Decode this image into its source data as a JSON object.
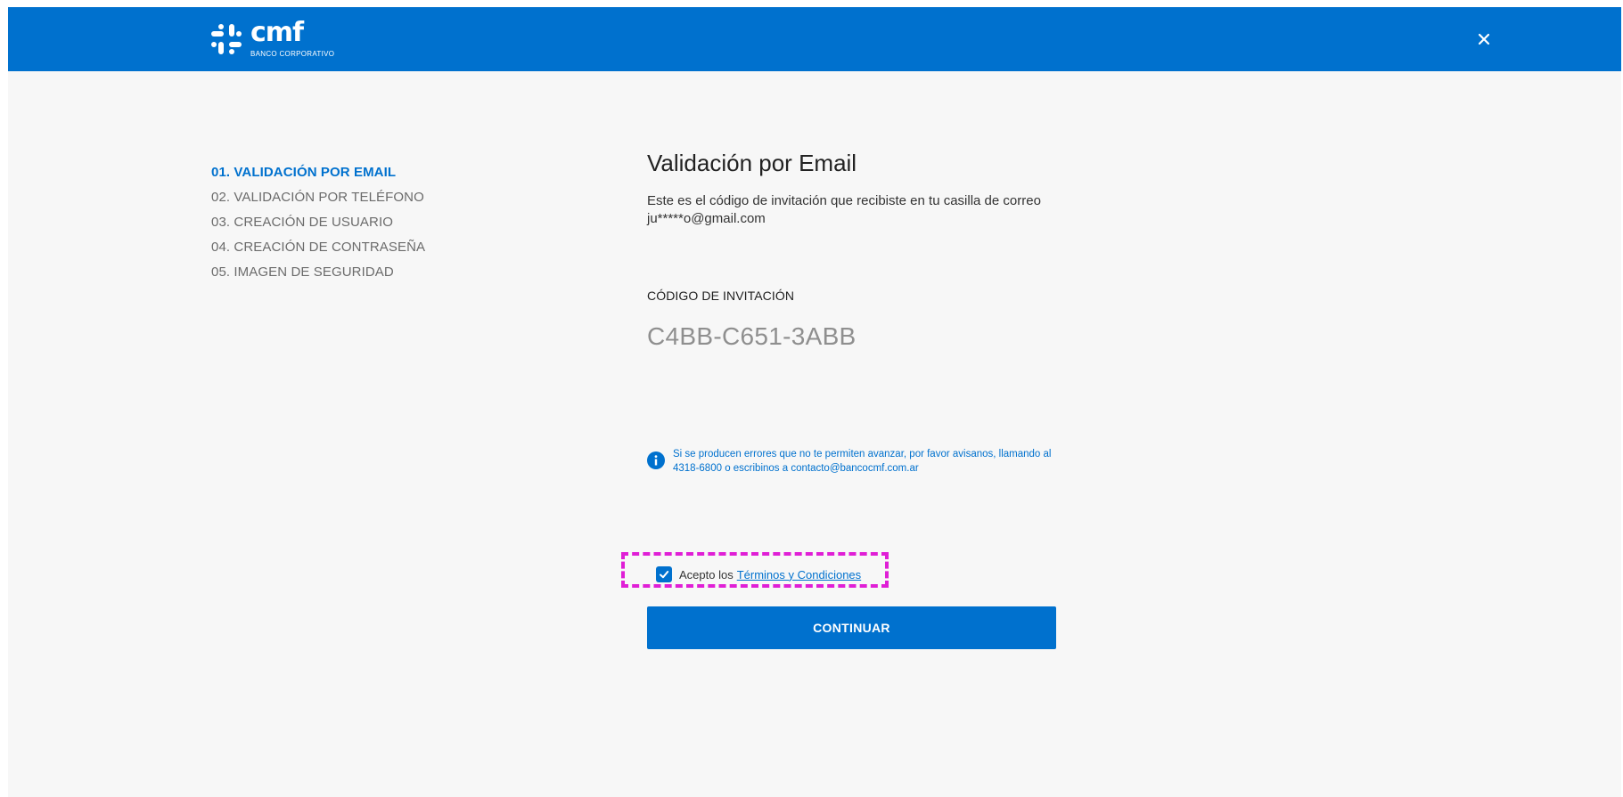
{
  "header": {
    "brand_name": "cmf",
    "brand_subtitle": "BANCO CORPORATIVO",
    "close_icon": "close-icon"
  },
  "steps": [
    {
      "label": "01. VALIDACIÓN POR EMAIL",
      "active": true
    },
    {
      "label": "02. VALIDACIÓN POR TELÉFONO",
      "active": false
    },
    {
      "label": "03. CREACIÓN DE USUARIO",
      "active": false
    },
    {
      "label": "04. CREACIÓN DE CONTRASEÑA",
      "active": false
    },
    {
      "label": "05. IMAGEN DE SEGURIDAD",
      "active": false
    }
  ],
  "main": {
    "title": "Validación por Email",
    "description": "Este es el código de invitación que recibiste en tu casilla de correo  ju*****o@gmail.com",
    "code_label": "CÓDIGO DE INVITACIÓN",
    "code_value": "C4BB-C651-3ABB",
    "info_icon": "info-icon",
    "info_text": "Si se producen errores que no te permiten avanzar, por favor avisanos, llamando al 4318-6800 o escribinos a contacto@bancocmf.com.ar",
    "terms_prefix": "Acepto los",
    "terms_link": "Términos y Condiciones",
    "terms_checked": true,
    "continue_label": "CONTINUAR"
  },
  "colors": {
    "brand_blue": "#0071ce",
    "background": "#f7f7f7",
    "highlight": "#e01fd6"
  }
}
